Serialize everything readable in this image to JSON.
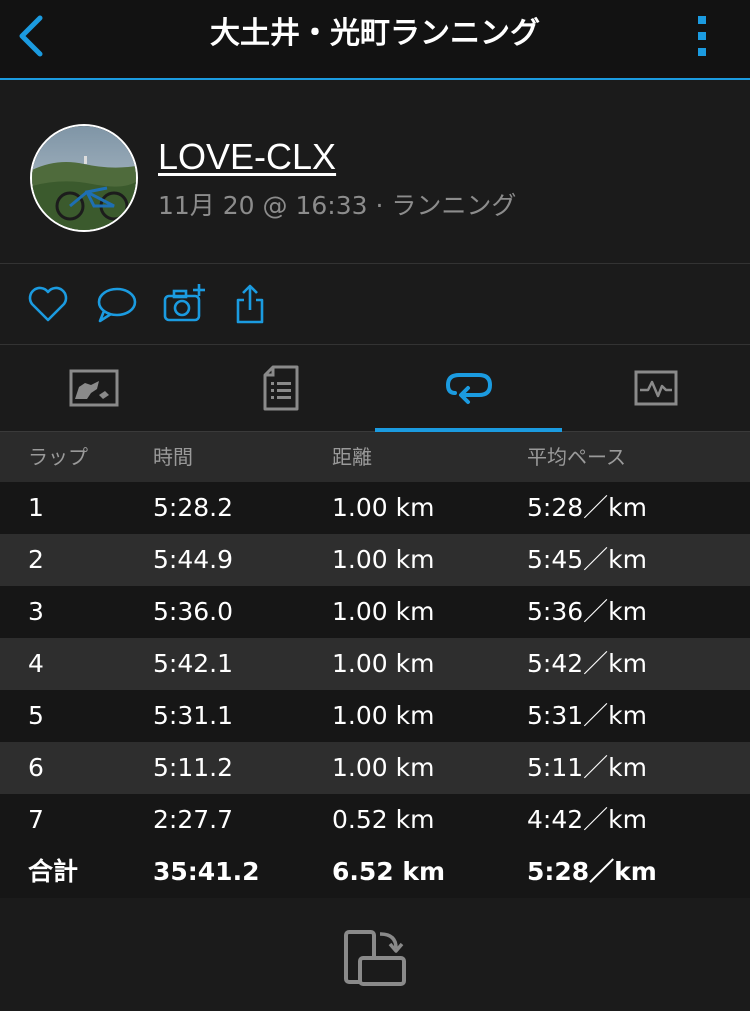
{
  "header": {
    "title": "大土井・光町ランニング",
    "back_icon": "chevron-left-icon",
    "menu_icon": "kebab-menu-icon"
  },
  "colors": {
    "accent": "#1b9be0",
    "background": "#1b1b1b"
  },
  "activity": {
    "user": "LOVE-CLX",
    "meta": "11月 20 @ 16:33 · ランニング"
  },
  "actions": [
    "heart-icon",
    "comment-icon",
    "add-photo-icon",
    "share-icon"
  ],
  "tabs": [
    {
      "icon": "map-icon",
      "active": false
    },
    {
      "icon": "details-icon",
      "active": false
    },
    {
      "icon": "laps-icon",
      "active": true
    },
    {
      "icon": "graph-icon",
      "active": false
    }
  ],
  "laps": {
    "headers": [
      "ラップ",
      "時間",
      "距離",
      "平均ペース"
    ],
    "rows": [
      [
        "1",
        "5:28.2",
        "1.00 km",
        "5:28／km"
      ],
      [
        "2",
        "5:44.9",
        "1.00 km",
        "5:45／km"
      ],
      [
        "3",
        "5:36.0",
        "1.00 km",
        "5:36／km"
      ],
      [
        "4",
        "5:42.1",
        "1.00 km",
        "5:42／km"
      ],
      [
        "5",
        "5:31.1",
        "1.00 km",
        "5:31／km"
      ],
      [
        "6",
        "5:11.2",
        "1.00 km",
        "5:11／km"
      ],
      [
        "7",
        "2:27.7",
        "0.52 km",
        "4:42／km"
      ]
    ],
    "total": [
      "合計",
      "35:41.2",
      "6.52 km",
      "5:28／km"
    ]
  },
  "footer": {
    "icon": "rotate-device-icon"
  }
}
